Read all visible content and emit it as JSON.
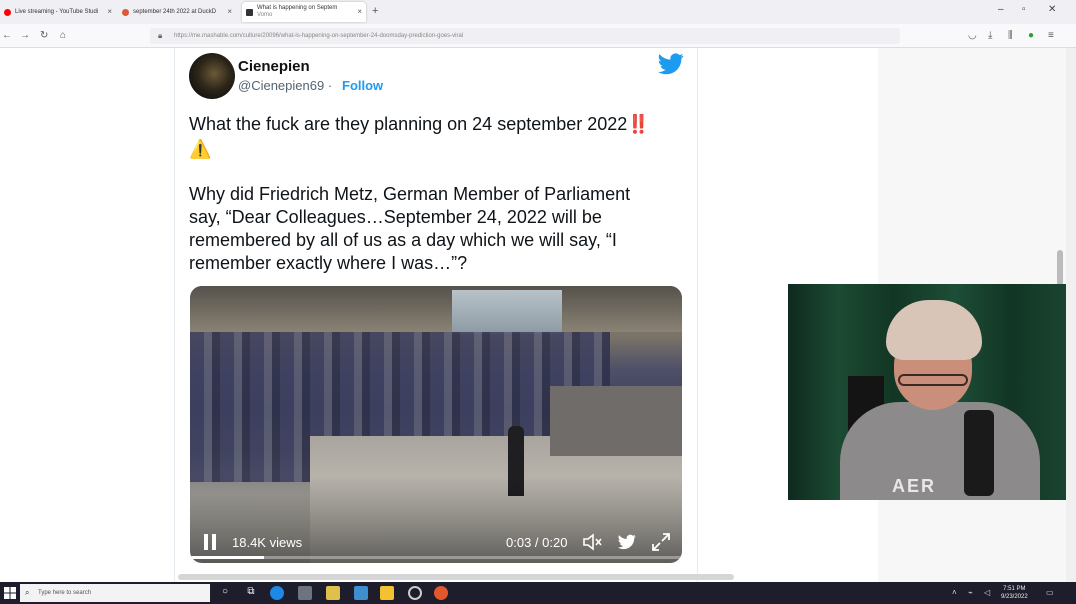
{
  "browser": {
    "tabs": [
      {
        "title": "Live streaming - YouTube Studi",
        "color": "#ff0000"
      },
      {
        "title": "september 24th 2022 at DuckD",
        "color": "#de5833"
      },
      {
        "title": "What is happening on Septem",
        "subtitle": "Vomo",
        "color": "#333333"
      }
    ],
    "url": "https://me.mashable.com/culture/20096/what-is-happening-on-september-24-doomsday-prediction-goes-viral"
  },
  "tweet": {
    "author": "Cienepien",
    "handle": "@Cienepien69",
    "separator": "·",
    "follow_label": "Follow",
    "line1": "What the fuck are they planning on 24 september 2022",
    "line1_emoji": "‼️",
    "line2_emoji": "⚠️",
    "body_lines": [
      "Why did Friedrich Metz, German Member of Parliament",
      "say, “Dear Colleagues…September 24, 2022 will be",
      "remembered by all of us as a day which we will say, “I",
      "remember exactly where I was…”?"
    ],
    "video": {
      "views": "18.4K views",
      "time": "0:03 / 0:20",
      "progress": 0.15
    }
  },
  "webcam": {
    "shirt_text": "AER"
  },
  "taskbar": {
    "search_placeholder": "Type here to search",
    "time": "7:51 PM",
    "date": "9/23/2022"
  },
  "colors": {
    "accent": "#1d9bf0",
    "taskbar": "#1d1d2b"
  }
}
